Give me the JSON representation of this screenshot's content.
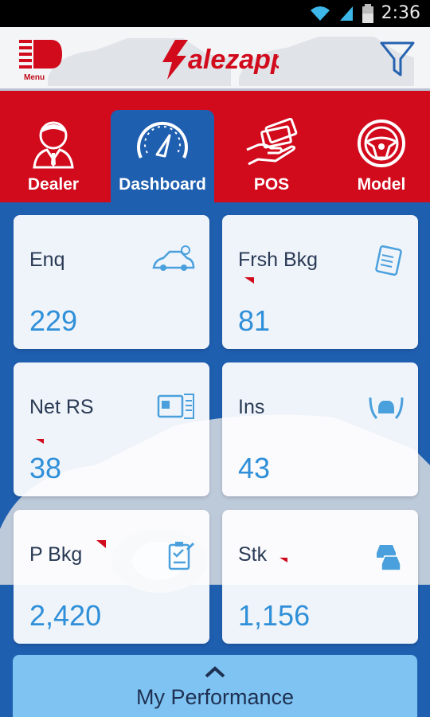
{
  "status": {
    "time": "2:36"
  },
  "header": {
    "menu_label": "Menu",
    "logo_text": "alezapp",
    "logo_prefix": "S"
  },
  "tabs": [
    {
      "label": "Dealer",
      "icon": "dealer-person-icon"
    },
    {
      "label": "Dashboard",
      "icon": "speedometer-icon",
      "active": true
    },
    {
      "label": "POS",
      "icon": "cash-hand-icon"
    },
    {
      "label": "Model",
      "icon": "steering-wheel-icon"
    }
  ],
  "cards": [
    {
      "title": "Enq",
      "value": "229",
      "icon": "car-enquiry-icon"
    },
    {
      "title": "Frsh Bkg",
      "value": "81",
      "icon": "booking-list-icon"
    },
    {
      "title": "Net RS",
      "value": "38",
      "icon": "document-card-icon"
    },
    {
      "title": "Ins",
      "value": "43",
      "icon": "car-lift-icon"
    },
    {
      "title": "P Bkg",
      "value": "2,420",
      "icon": "clipboard-check-icon"
    },
    {
      "title": "Stk",
      "value": "1,156",
      "icon": "cars-stock-icon"
    }
  ],
  "performance": {
    "label": "My Performance"
  },
  "colors": {
    "brand_red": "#d10a1c",
    "brand_blue": "#1f5fb0",
    "value_blue": "#2f8fd8"
  }
}
